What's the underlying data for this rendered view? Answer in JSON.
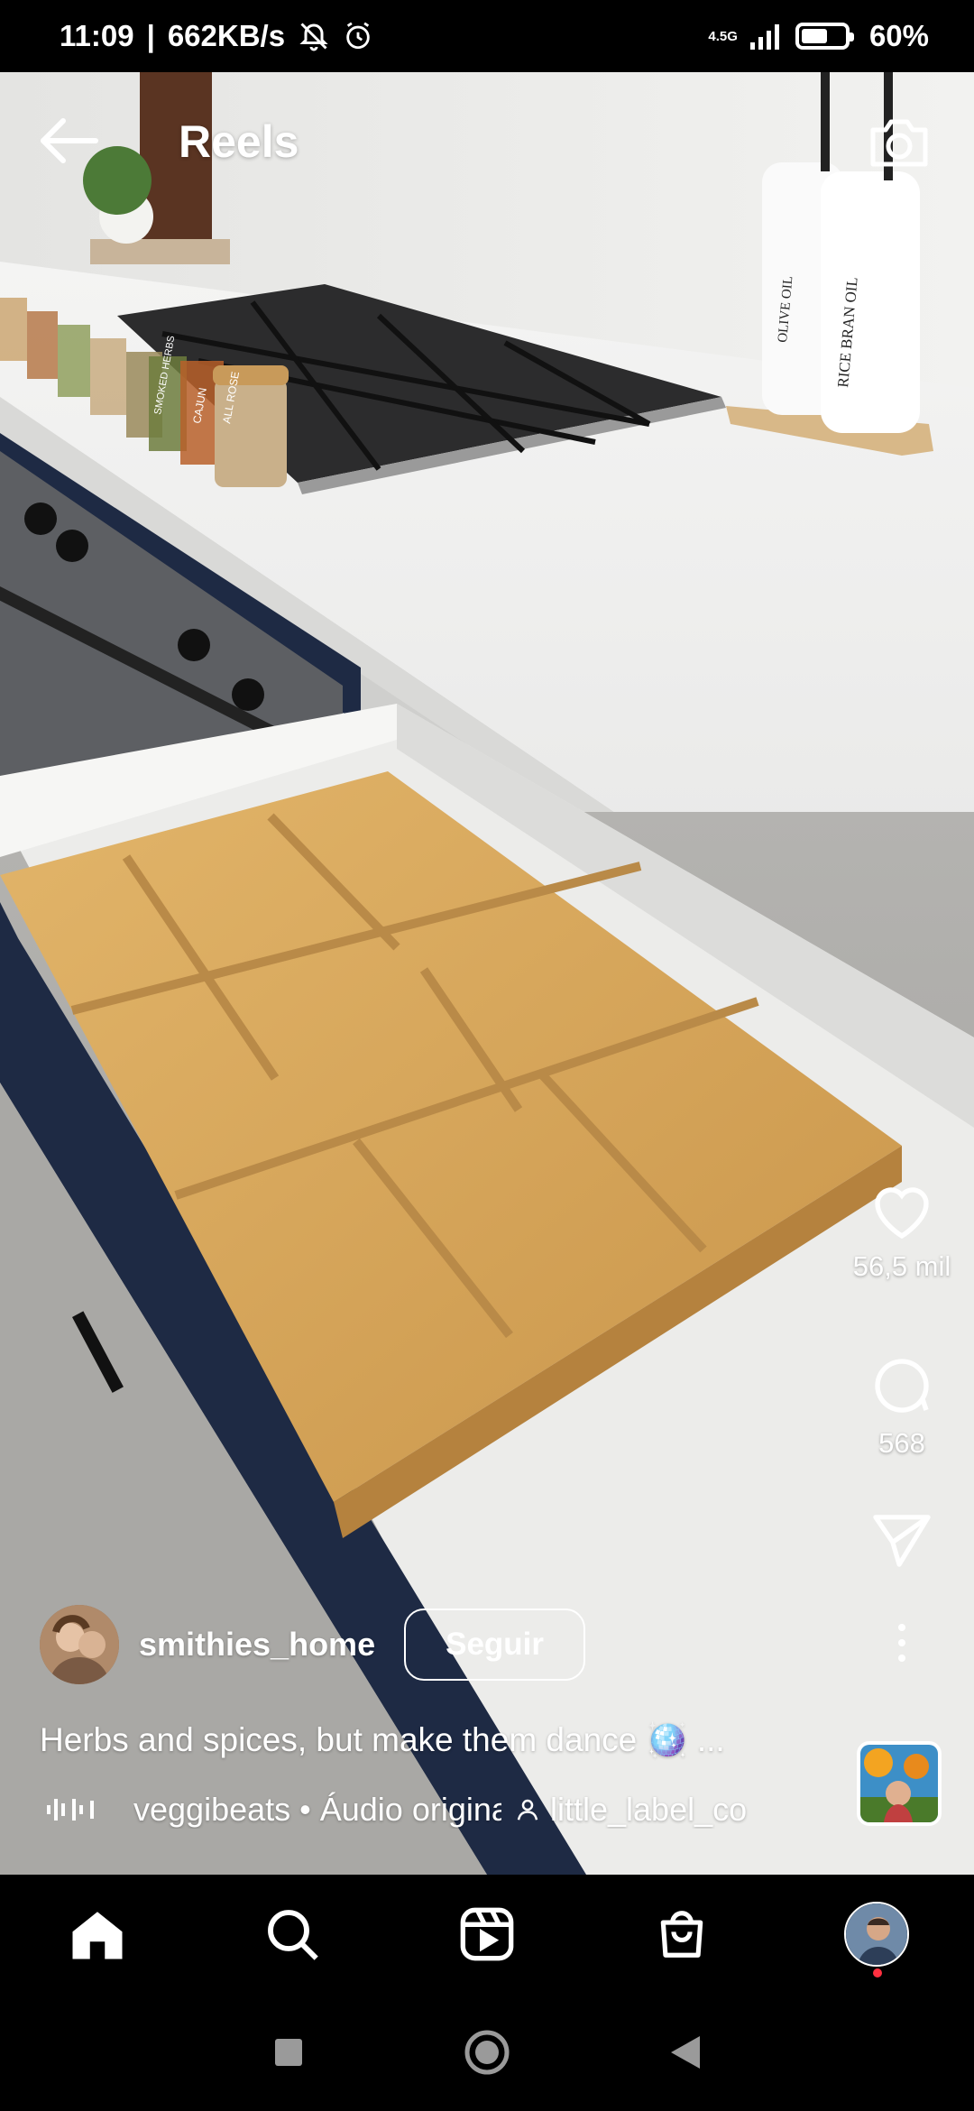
{
  "status_bar": {
    "time": "11:09",
    "speed": "662KB/s",
    "network": "4.5G",
    "battery_pct": "60%",
    "battery_level": 0.6
  },
  "header": {
    "title": "Reels",
    "back_icon": "arrow-left-icon",
    "camera_icon": "camera-icon"
  },
  "actions": {
    "likes": "56,5 mil",
    "comments": "568"
  },
  "post": {
    "username": "smithies_home",
    "follow_label": "Seguir",
    "caption": "Herbs and spices, but make them dance 🪩 ...",
    "audio": "veggibeats • Áudio original",
    "tagged_user": "little_label_co"
  },
  "scene_labels": {
    "olive_oil": "OLIVE OIL",
    "rice_bran_oil": "RICE BRAN OIL",
    "jar1": "SMOKED HERBS",
    "jar2": "CAJUN",
    "jar3": "ALL ROSE"
  },
  "colors": {
    "accent_red": "#ff3040",
    "wood": "#d9a85b",
    "cabinet_navy": "#1e2a44"
  }
}
